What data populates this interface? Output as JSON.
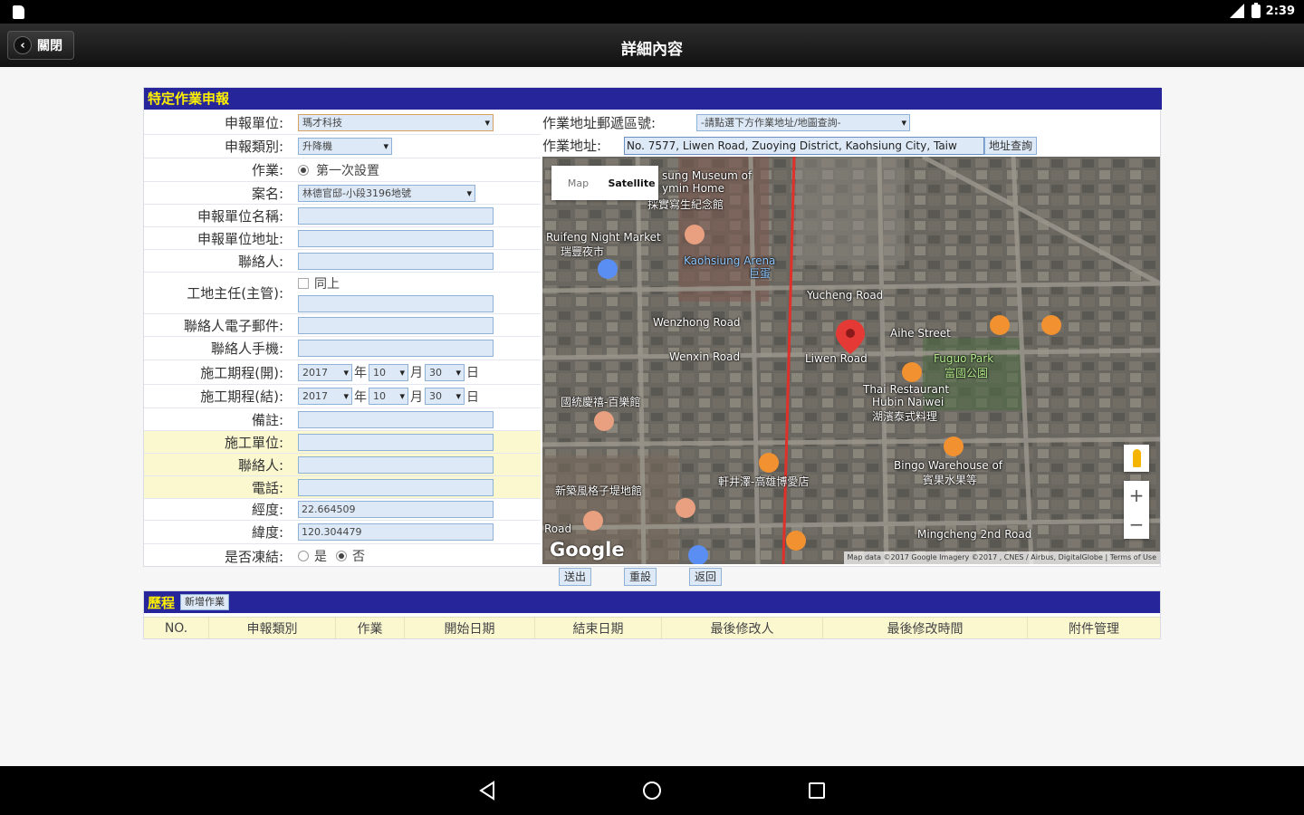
{
  "status_bar": {
    "time": "2:39"
  },
  "app_bar": {
    "back_label": "關閉",
    "title": "詳細內容"
  },
  "form": {
    "section_title": "特定作業申報",
    "fields": [
      {
        "label": "申報單位:",
        "value": "瑪才科技"
      },
      {
        "label": "申報類別:",
        "value": "升降機"
      },
      {
        "label": "作業:",
        "value": "第一次設置"
      },
      {
        "label": "案名:",
        "value": "林德官邸-小段3196地號"
      },
      {
        "label": "申報單位名稱:",
        "value": ""
      },
      {
        "label": "申報單位地址:",
        "value": ""
      },
      {
        "label": "聯絡人:",
        "value": ""
      },
      {
        "label": "工地主任(主管):",
        "value": "",
        "checkbox_label": "同上"
      },
      {
        "label": "聯絡人電子郵件:",
        "value": ""
      },
      {
        "label": "聯絡人手機:",
        "value": ""
      },
      {
        "label": "施工期程(開):",
        "year": "2017",
        "year_unit": "年",
        "month": "10",
        "month_unit": "月",
        "day": "30",
        "day_unit": "日"
      },
      {
        "label": "施工期程(結):",
        "year": "2017",
        "year_unit": "年",
        "month": "10",
        "month_unit": "月",
        "day": "30",
        "day_unit": "日"
      },
      {
        "label": "備註:",
        "value": ""
      },
      {
        "label": "施工單位:",
        "value": ""
      },
      {
        "label": "聯絡人:",
        "value": ""
      },
      {
        "label": "電話:",
        "value": ""
      },
      {
        "label": "經度:",
        "value": "22.664509"
      },
      {
        "label": "緯度:",
        "value": "120.304479"
      },
      {
        "label": "是否凍結:",
        "yes": "是",
        "no": "否"
      }
    ]
  },
  "address": {
    "postal_label": "作業地址郵遞區號:",
    "postal_value": "-請點選下方作業地址/地圖查詢-",
    "address_label": "作業地址:",
    "address_value": "No. 7577, Liwen Road, Zuoying District, Kaohsiung City, Taiw",
    "lookup_button": "地址查詢"
  },
  "map": {
    "type_map": "Map",
    "type_satellite": "Satellite",
    "logo": "Google",
    "attribution": "Map data ©2017 Google Imagery ©2017 , CNES / Airbus, DigitalGlobe | Terms of Use",
    "zoom_in": "+",
    "zoom_out": "−",
    "labels": {
      "museum": "sung Museum of",
      "museum2": "ymin Home",
      "museum3": "採實寫生紀念館",
      "night_market": "Ruifeng Night Market",
      "night_market_zh": "瑞豐夜市",
      "arena": "Kaohsiung Arena",
      "arena_zh": "巨蛋",
      "yucheng": "Yucheng Road",
      "wenzhong": "Wenzhong Road",
      "wenxin": "Wenxin Road",
      "liwen": "Liwen Road",
      "aihe": "Aihe Street",
      "fuguo": "Fuguo Park",
      "fuguo_zh": "富國公園",
      "thai": "Thai Restaurant",
      "thai2": "Hubin Naiwei",
      "thai_zh": "湖濱泰式料理",
      "hotel": "國統慶禧-百樂館",
      "bingo": "Bingo Warehouse of",
      "bingo_zh": "賓果水果等",
      "jiazhong": "軒井澤-高雄博愛店",
      "zhongxing": "新築風格子堤地館",
      "mingcheng": "Mingcheng 2nd Road",
      "road": "Road"
    }
  },
  "actions": {
    "submit": "送出",
    "reset": "重設",
    "back": "返回"
  },
  "history": {
    "title": "歷程",
    "new_button": "新增作業",
    "columns": [
      "NO.",
      "申報類別",
      "作業",
      "開始日期",
      "結束日期",
      "最後修改人",
      "最後修改時間",
      "附件管理"
    ]
  }
}
